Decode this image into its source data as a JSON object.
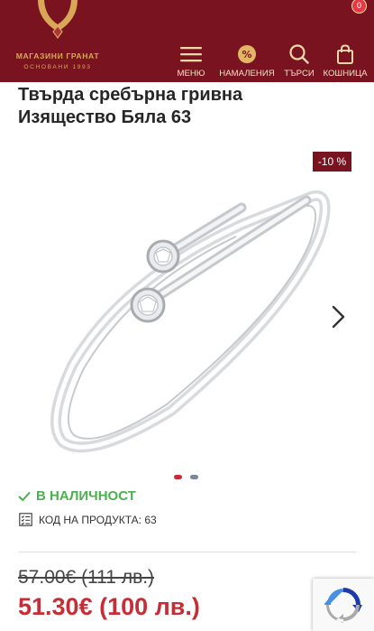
{
  "header": {
    "logo_name": "МАГАЗИНИ ГРАНАТ",
    "logo_subtitle": "ОСНОВАНИ 1993",
    "colors": {
      "background": "#7a1320",
      "gold": "#d8a857"
    },
    "nav": [
      {
        "label": "МЕНЮ",
        "icon": "hamburger-icon"
      },
      {
        "label": "НАМАЛЕНИЯ",
        "icon": "percent-icon"
      },
      {
        "label": "ТЪРСИ",
        "icon": "search-icon"
      },
      {
        "label": "КОШНИЦА",
        "icon": "shopping-bag-icon"
      }
    ],
    "cart_count": "0"
  },
  "product": {
    "title_line1": "Твърда сребърна гривна",
    "title_line2": "Изящество Бяла 63",
    "discount_badge": "-10 %",
    "image_icon": "silver-bangle-image",
    "gallery": {
      "slides": 2,
      "active": 1
    },
    "stock_status": "В НАЛИЧНОСТ",
    "code_label": "КОД НА ПРОДУКТА:",
    "code_value": "63",
    "old_price": "57.00€ (111 лв.)",
    "new_price": "51.30€ (100 лв.)",
    "colors": {
      "price": "#c62d36",
      "stock": "#4caf50"
    }
  },
  "widgets": {
    "recaptcha_icon": "recaptcha-icon"
  }
}
